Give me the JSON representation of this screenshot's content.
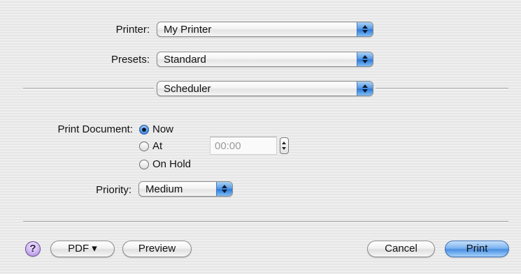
{
  "printer": {
    "label": "Printer:",
    "value": "My Printer"
  },
  "presets": {
    "label": "Presets:",
    "value": "Standard"
  },
  "panel": {
    "value": "Scheduler"
  },
  "scheduler": {
    "print_document_label": "Print Document:",
    "options": [
      {
        "label": "Now",
        "selected": true
      },
      {
        "label": "At",
        "selected": false
      },
      {
        "label": "On Hold",
        "selected": false
      }
    ],
    "time_value": "00:00",
    "priority_label": "Priority:",
    "priority_value": "Medium"
  },
  "footer": {
    "help_glyph": "?",
    "pdf_label": "PDF ▾",
    "preview_label": "Preview",
    "cancel_label": "Cancel",
    "print_label": "Print"
  },
  "colors": {
    "accent": "#4a8fe3",
    "help": "#cfb6f2"
  }
}
